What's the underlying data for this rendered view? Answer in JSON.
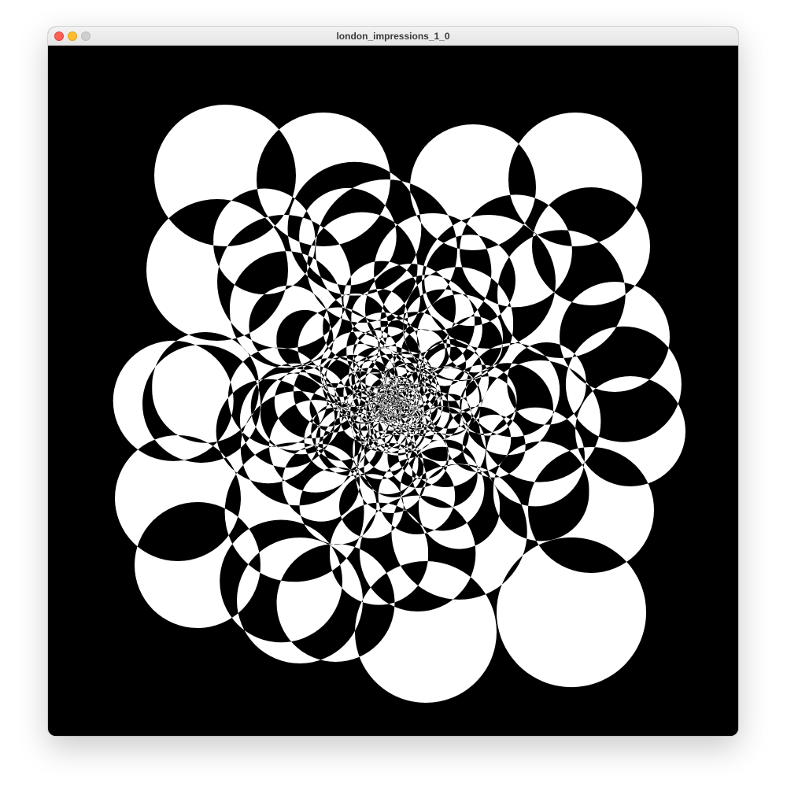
{
  "window": {
    "title": "london_impressions_1_0",
    "controls": {
      "close": "close-icon",
      "minimize": "minimize-icon",
      "zoom": "zoom-icon"
    }
  },
  "sketch": {
    "background_color": "#000000",
    "foreground_color": "#ffffff",
    "style": "overlapping circles with even-odd black/white fill"
  }
}
